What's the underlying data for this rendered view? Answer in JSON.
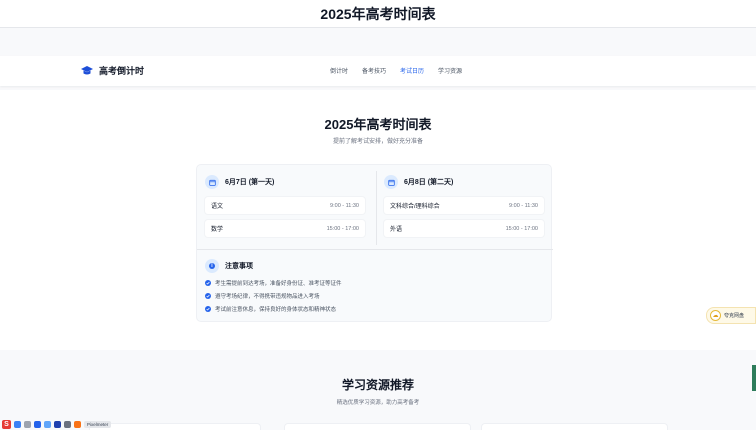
{
  "top_title": "2025年高考时间表",
  "brand": {
    "name": "高考倒计时",
    "icon": "graduation-cap-icon"
  },
  "nav": {
    "items": [
      {
        "label": "倒计时"
      },
      {
        "label": "备考技巧"
      },
      {
        "label": "考试日历"
      },
      {
        "label": "学习资源"
      }
    ],
    "active_index": 2
  },
  "hero": {
    "title": "2025年高考时间表",
    "subtitle": "提前了解考试安排，做好充分准备"
  },
  "schedule": {
    "days": [
      {
        "title": "6月7日 (第一天)",
        "exams": [
          {
            "subject": "语文",
            "time": "9:00 - 11:30"
          },
          {
            "subject": "数学",
            "time": "15:00 - 17:00"
          }
        ]
      },
      {
        "title": "6月8日 (第二天)",
        "exams": [
          {
            "subject": "文科综合/理科综合",
            "time": "9:00 - 11:30"
          },
          {
            "subject": "外语",
            "time": "15:00 - 17:00"
          }
        ]
      }
    ]
  },
  "notes": {
    "title": "注意事项",
    "items": [
      "考生需提前到达考场，准备好身份证、准考证等证件",
      "遵守考场纪律，不得携带违规物品进入考场",
      "考试前注意休息，保持良好的身体状态和精神状态"
    ]
  },
  "resources": {
    "title": "学习资源推荐",
    "subtitle": "精选优质学习资源，助力高考备考"
  },
  "float_widget": {
    "label": "夸克网盘",
    "icon": "cloud-icon"
  },
  "tray": {
    "pill": "Pixelmeter"
  },
  "colors": {
    "accent": "#2563eb",
    "accent_light": "#dbeafe",
    "text": "#111827",
    "muted": "#6b7280"
  }
}
